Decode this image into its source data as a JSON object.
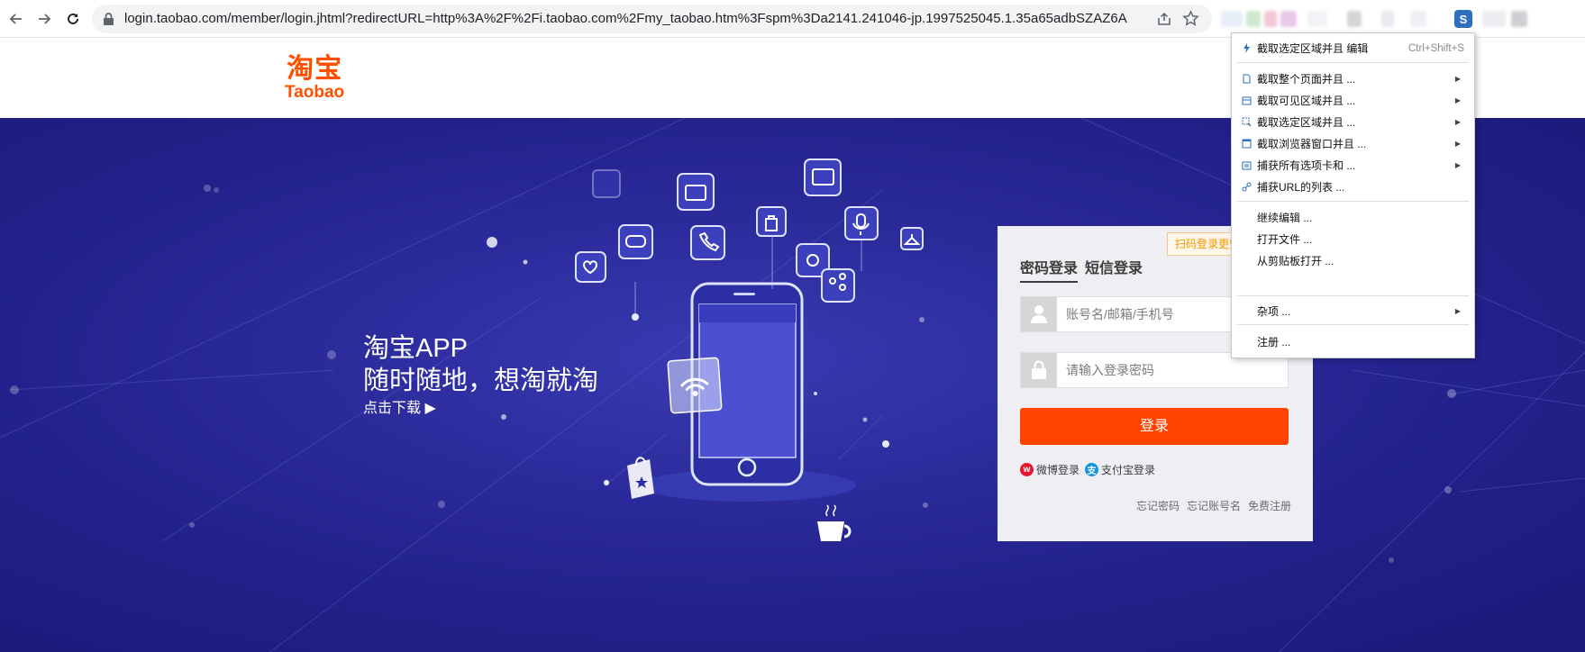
{
  "browser": {
    "url": "login.taobao.com/member/login.jhtml?redirectURL=http%3A%2F%2Fi.taobao.com%2Fmy_taobao.htm%3Fspm%3Da2141.241046-jp.1997525045.1.35a65adbSZAZ6A",
    "extension_icon_letter": "S"
  },
  "header": {
    "logo_cn": "淘宝",
    "logo_en": "Taobao"
  },
  "promo": {
    "line1": "淘宝APP",
    "line2": "随时随地，想淘就淘",
    "download": "点击下载 ▶"
  },
  "login": {
    "qr_tip": "扫码登录更安全",
    "tabs": [
      {
        "label": "密码登录",
        "active": true
      },
      {
        "label": "短信登录",
        "active": false
      }
    ],
    "username_placeholder": "账号名/邮箱/手机号",
    "password_placeholder": "请输入登录密码",
    "submit_label": "登录",
    "weibo_label": "微博登录",
    "alipay_label": "支付宝登录",
    "links": [
      "忘记密码",
      "忘记账号名",
      "免费注册"
    ]
  },
  "context_menu": {
    "items": [
      {
        "label": "截取选定区域并且 编辑",
        "shortcut": "Ctrl+Shift+S",
        "icon": "lightning-icon",
        "submenu": false
      },
      {
        "label": "截取整个页面并且 ...",
        "icon": "page-icon",
        "submenu": true
      },
      {
        "label": "截取可见区域并且 ...",
        "icon": "visible-area-icon",
        "submenu": true
      },
      {
        "label": "截取选定区域并且 ...",
        "icon": "selection-icon",
        "submenu": true
      },
      {
        "label": "截取浏览器窗口并且 ...",
        "icon": "window-icon",
        "submenu": true
      },
      {
        "label": "捕获所有选项卡和 ...",
        "icon": "tabs-icon",
        "submenu": true
      },
      {
        "label": "捕获URL的列表 ...",
        "icon": "link-icon",
        "submenu": false
      },
      {
        "label": "继续编辑 ...",
        "submenu": false
      },
      {
        "label": "打开文件 ...",
        "submenu": false
      },
      {
        "label": "从剪贴板打开 ...",
        "submenu": false
      },
      {
        "label": "杂项 ...",
        "submenu": true
      },
      {
        "label": "注册 ...",
        "submenu": false
      }
    ]
  },
  "colors": {
    "brand_orange": "#ff5000",
    "login_button": "#ff4400",
    "hero_bg": "#2a2a9a"
  }
}
